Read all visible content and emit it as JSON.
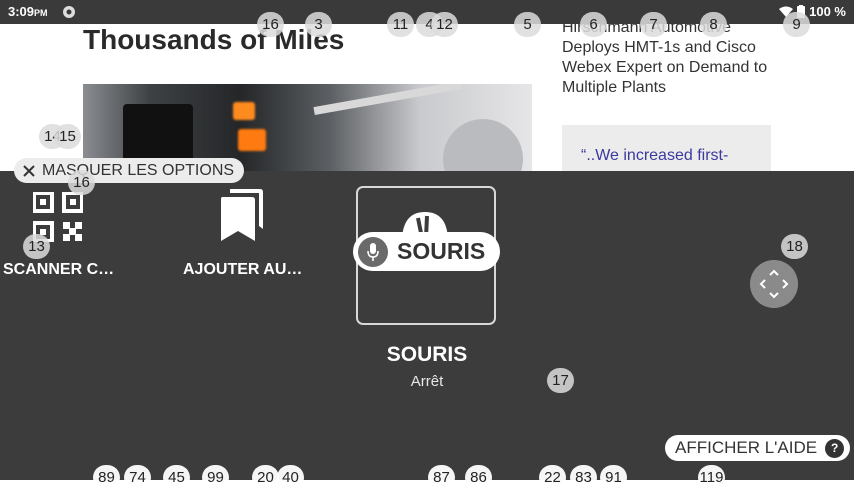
{
  "status_bar": {
    "time": "3:09",
    "ampm": "PM",
    "battery": "100 %"
  },
  "article": {
    "headline": "Thousands of Miles",
    "side_text": "Hirschmann Automotive Deploys HMT-1s and Cisco Webex Expert on Demand to Multiple Plants",
    "quote": "“..We increased first-"
  },
  "overlay": {
    "hide_options": "MASQUER LES OPTIONS",
    "tiles": [
      {
        "label": "SCANNER C…",
        "icon": "qr-code-icon"
      },
      {
        "label": "AJOUTER AU…",
        "icon": "bookmarks-icon"
      }
    ],
    "voice_command": "SOURIS",
    "mode_title": "SOURIS",
    "mode_status": "Arrêt",
    "help_button": "AFFICHER L'AIDE",
    "help_icon": "?"
  },
  "badges": {
    "top": [
      "16",
      "3",
      "11",
      "4",
      "12",
      "5",
      "6",
      "7",
      "8",
      "9"
    ],
    "left": [
      "14",
      "15",
      "16",
      "13"
    ],
    "right": [
      "18",
      "17"
    ],
    "bottom": [
      "89",
      "74",
      "45",
      "99",
      "20",
      "40",
      "87",
      "86",
      "22",
      "83",
      "91",
      "119"
    ]
  },
  "colors": {
    "overlay_bg": "#3c3c3c",
    "status_bar_bg": "#3a3a3a",
    "quote_link": "#3b3a9c"
  }
}
